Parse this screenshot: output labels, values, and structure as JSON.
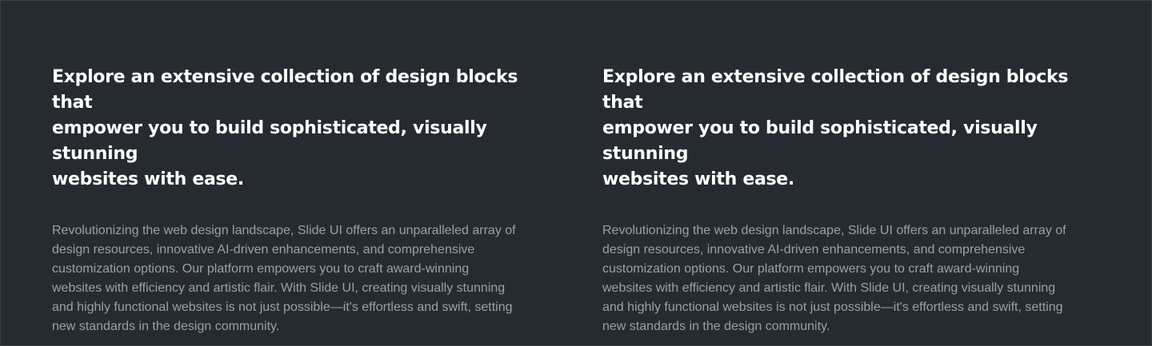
{
  "columns": [
    {
      "heading_lines": [
        "Explore an extensive collection of design blocks that",
        "empower you to build sophisticated, visually stunning",
        "websites with ease."
      ],
      "body_lines": [
        "Revolutionizing the web design landscape, Slide UI offers an unparalleled array of",
        "design resources, innovative AI-driven enhancements, and comprehensive",
        "customization options. Our platform empowers you to craft award-winning",
        "websites with efficiency and artistic flair. With Slide UI, creating visually stunning",
        "and highly functional websites is not just possible—it's effortless and swift, setting",
        "new standards in the design community."
      ]
    },
    {
      "heading_lines": [
        "Explore an extensive collection of design blocks that",
        "empower you to build sophisticated, visually stunning",
        "websites with ease."
      ],
      "body_lines": [
        "Revolutionizing the web design landscape, Slide UI offers an unparalleled array of",
        "design resources, innovative AI-driven enhancements, and comprehensive",
        "customization options. Our platform empowers you to craft award-winning",
        "websites with efficiency and artistic flair. With Slide UI, creating visually stunning",
        "and highly functional websites is not just possible—it's effortless and swift, setting",
        "new standards in the design community."
      ]
    }
  ],
  "colors": {
    "background": "#262b31",
    "heading": "#ffffff",
    "body": "#9aa0a8"
  }
}
